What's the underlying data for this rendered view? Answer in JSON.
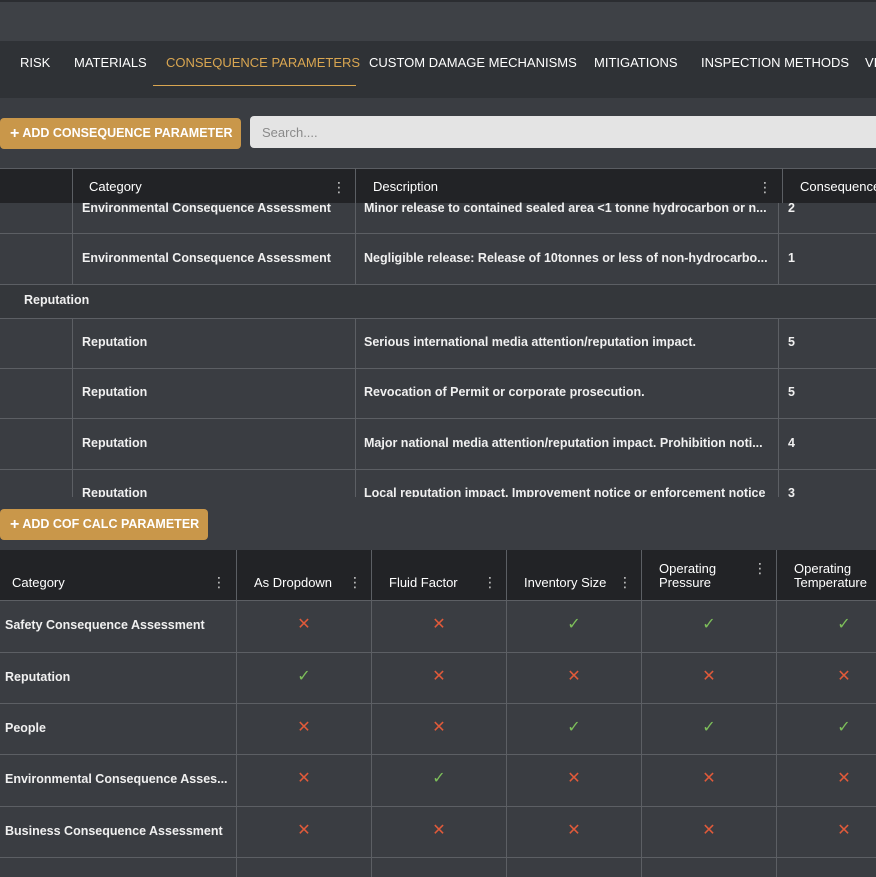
{
  "tabs": [
    {
      "label": "RISK"
    },
    {
      "label": "MATERIALS"
    },
    {
      "label": "CONSEQUENCE PARAMETERS"
    },
    {
      "label": "CUSTOM DAMAGE MECHANISMS"
    },
    {
      "label": "MITIGATIONS"
    },
    {
      "label": "INSPECTION METHODS"
    },
    {
      "label": "VI"
    }
  ],
  "toolbar": {
    "add_consequence_label": "ADD CONSEQUENCE PARAMETER",
    "search_placeholder": "Search....",
    "add_cof_label": "ADD COF CALC PARAMETER"
  },
  "grid1": {
    "columns": [
      "Category",
      "Description",
      "Consequence"
    ],
    "rows": [
      {
        "category": "Environmental Consequence Assessment",
        "description": "Minor release to contained sealed area <1 tonne hydrocarbon or n...",
        "value": "2"
      },
      {
        "category": "Environmental Consequence Assessment",
        "description": "Negligible release: Release of 10tonnes or less of non-hydrocarbo...",
        "value": "1"
      }
    ],
    "group_label": "Reputation",
    "group_rows": [
      {
        "category": "Reputation",
        "description": "Serious international media attention/reputation impact.",
        "value": "5"
      },
      {
        "category": "Reputation",
        "description": "Revocation of Permit or corporate prosecution.",
        "value": "5"
      },
      {
        "category": "Reputation",
        "description": "Major national media attention/reputation impact. Prohibition noti...",
        "value": "4"
      },
      {
        "category": "Reputation",
        "description": "Local reputation impact. Improvement notice or enforcement notice",
        "value": "3"
      }
    ]
  },
  "grid2": {
    "columns": [
      "Category",
      "As Dropdown",
      "Fluid Factor",
      "Inventory Size",
      "Operating Pressure",
      "Operating Temperature"
    ],
    "rows": [
      {
        "category": "Safety Consequence Assessment",
        "flags": [
          false,
          false,
          true,
          true,
          true
        ]
      },
      {
        "category": "Reputation",
        "flags": [
          true,
          false,
          false,
          false,
          false
        ]
      },
      {
        "category": "People",
        "flags": [
          false,
          false,
          true,
          true,
          true
        ]
      },
      {
        "category": "Environmental Consequence Asses...",
        "flags": [
          false,
          true,
          false,
          false,
          false
        ]
      },
      {
        "category": "Business Consequence Assessment",
        "flags": [
          false,
          false,
          false,
          false,
          false
        ]
      }
    ]
  },
  "icons": {
    "check": "check-icon",
    "cross": "cross-icon",
    "menu": "kebab-menu-icon",
    "plus": "plus-icon"
  },
  "colors": {
    "accent": "#d9a651",
    "button": "#c9974a",
    "check": "#7dbf5a",
    "cross": "#e05a3a"
  }
}
